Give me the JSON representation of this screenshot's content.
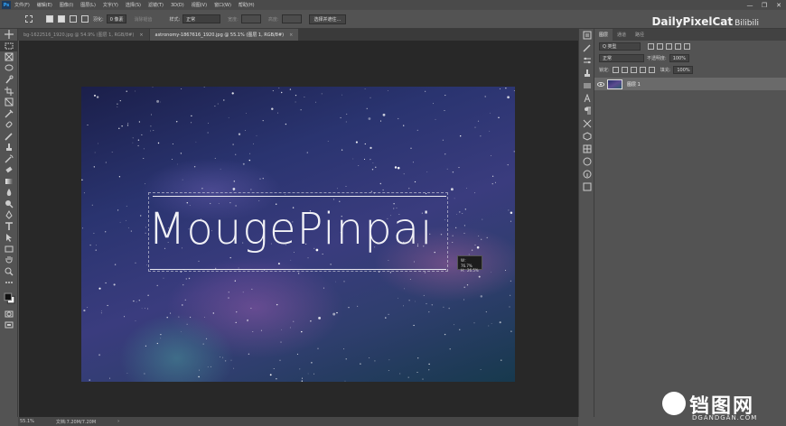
{
  "menubar": {
    "app_icon": "Ps",
    "items": [
      "文件(F)",
      "编辑(E)",
      "图像(I)",
      "图层(L)",
      "文字(Y)",
      "选择(S)",
      "滤镜(T)",
      "3D(D)",
      "视图(V)",
      "窗口(W)",
      "帮助(H)"
    ],
    "window_buttons": [
      "—",
      "❐",
      "✕"
    ]
  },
  "options": {
    "feather_label": "羽化:",
    "feather_value": "0 像素",
    "antialias_label": "消除锯齿",
    "style_label": "样式:",
    "style_value": "正常",
    "width_label": "宽度:",
    "height_label": "高度:",
    "select_mask_button": "选择并遮住..."
  },
  "watermark_top": {
    "text": "DailyPixelCat",
    "bili": "Bilibili"
  },
  "tabs": [
    {
      "label": "bg-1622516_1920.jpg @ 54.9% (图层 1, RGB/8#)",
      "close": "×",
      "active": false
    },
    {
      "label": "astronomy-1867616_1920.jpg @ 55.1% (图层 1, RGB/8#)",
      "close": "×",
      "active": true
    }
  ],
  "canvas": {
    "title_text": "MougePinpai",
    "tooltip_w": "W：76.7%",
    "tooltip_h": "H：26.5%"
  },
  "layers_panel": {
    "tabs": [
      "图层",
      "通道",
      "路径"
    ],
    "filter_kind": "Q 类型",
    "blend_mode": "正常",
    "opacity_label": "不透明度:",
    "opacity_value": "100%",
    "lock_label": "锁定:",
    "fill_label": "填充:",
    "fill_value": "100%",
    "layer_name": "图层 1"
  },
  "status": {
    "zoom": "55.1%",
    "doc_size": "文档:7.20M/7.20M",
    "arrow": "›"
  },
  "site_logo": {
    "cn": "铛图网",
    "en": "DGANDGAN.COM"
  }
}
